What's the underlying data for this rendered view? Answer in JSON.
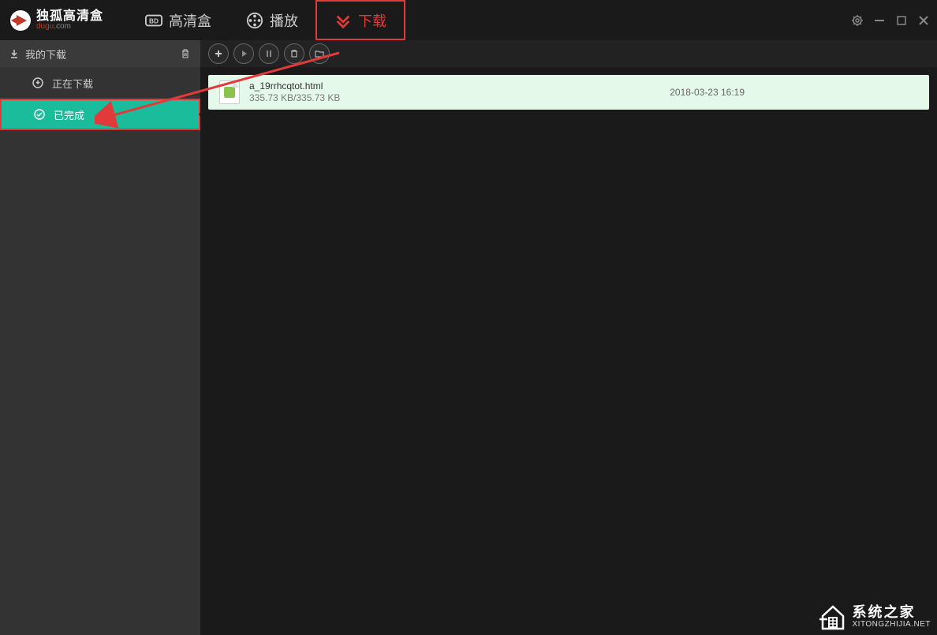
{
  "logo": {
    "title": "独孤高清盒",
    "sub_a": "dugu",
    "sub_b": ".com"
  },
  "header_tabs": {
    "hd_box": "高清盒",
    "play": "播放",
    "download": "下载"
  },
  "sidebar": {
    "header": "我的下载",
    "items": [
      {
        "label": "正在下载"
      },
      {
        "label": "已完成"
      }
    ]
  },
  "files": [
    {
      "name": "a_19rrhcqtot.html",
      "size": "335.73 KB/335.73 KB",
      "date": "2018-03-23 16:19"
    }
  ],
  "watermark": {
    "title": "系统之家",
    "sub": "XITONGZHIJIA.NET"
  }
}
